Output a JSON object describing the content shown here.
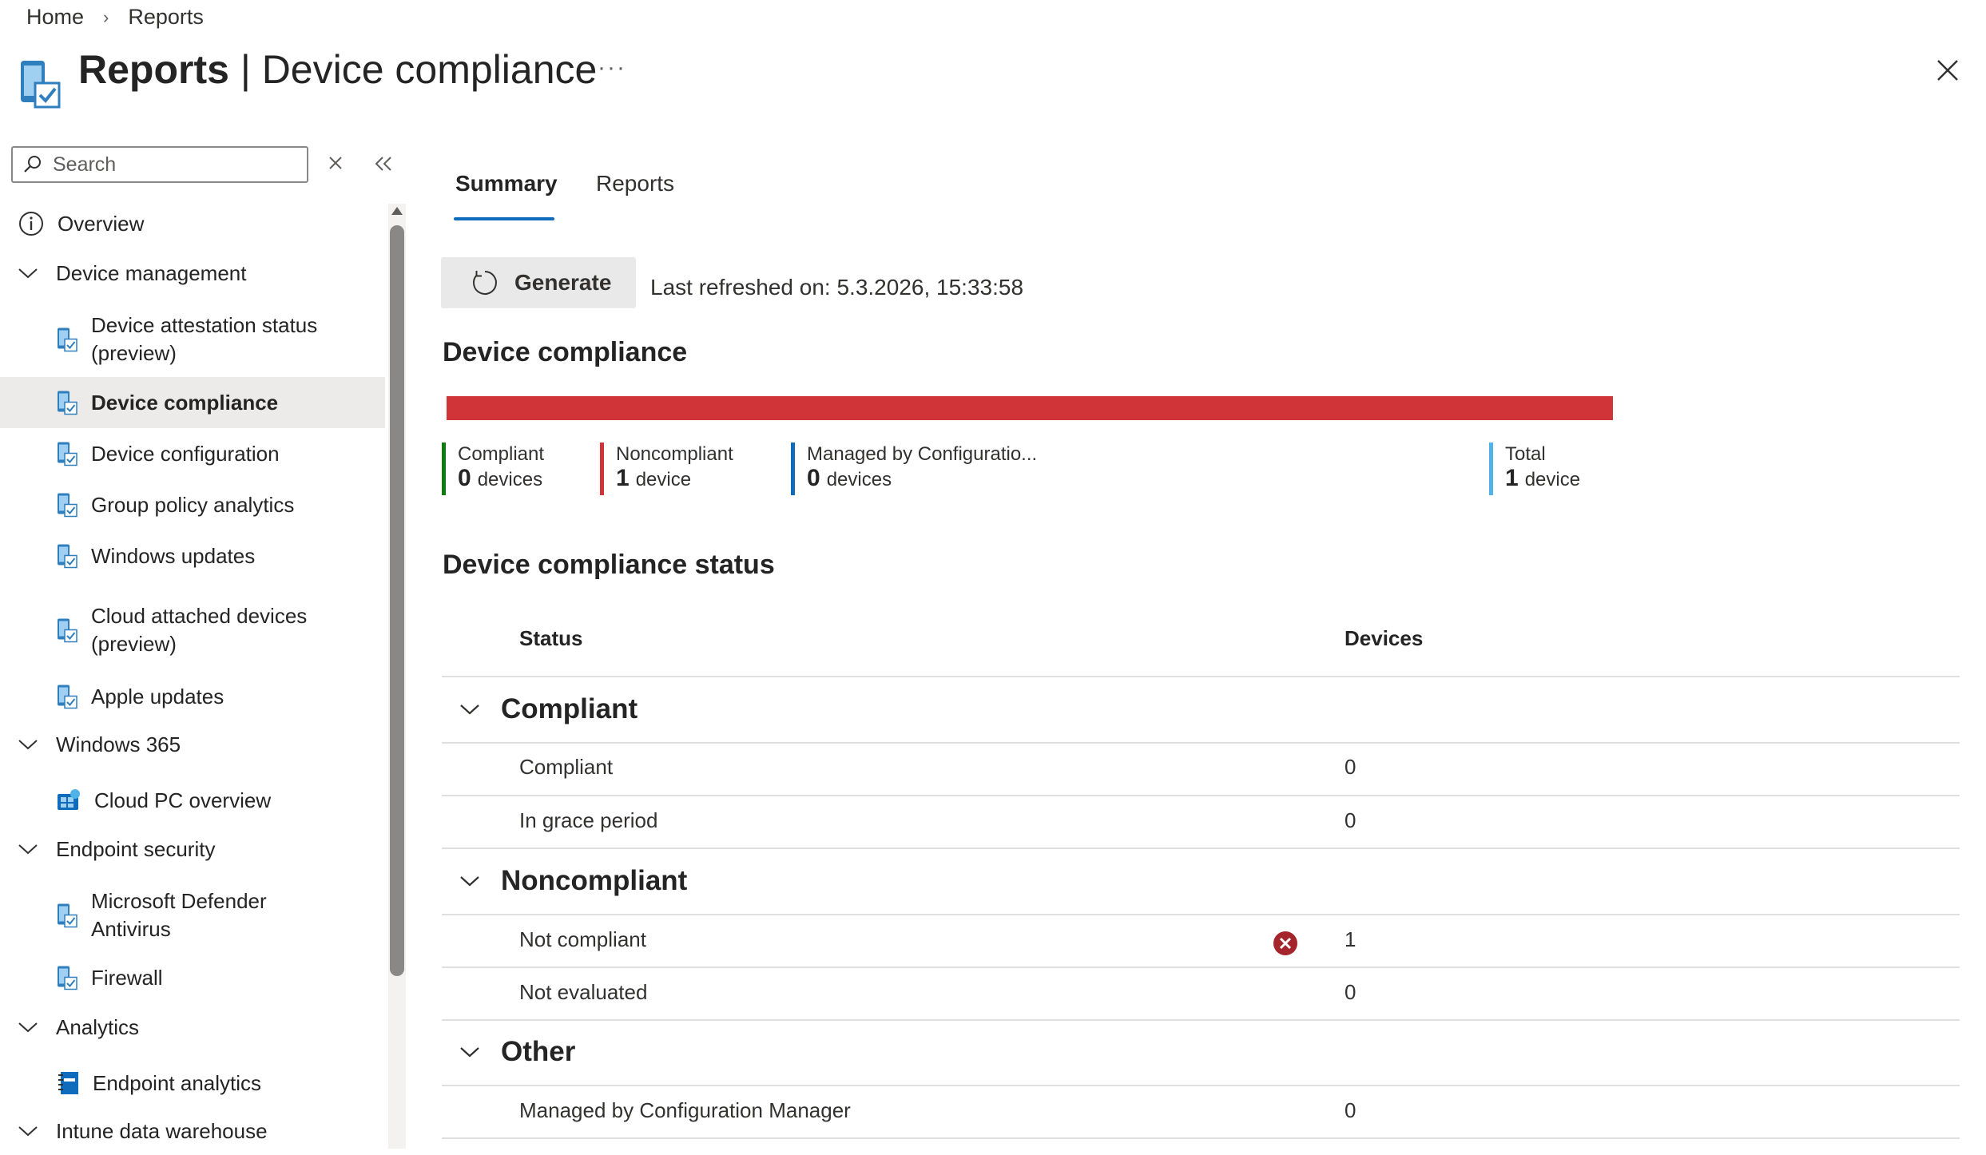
{
  "breadcrumb": {
    "home": "Home",
    "current": "Reports"
  },
  "header": {
    "title_bold": "Reports",
    "title_rest": " | Device compliance",
    "more": "···",
    "icon": "device-check-icon"
  },
  "sidebar": {
    "search_placeholder": "Search",
    "items": [
      {
        "label": "Overview",
        "icon": "info-icon",
        "type": "top"
      },
      {
        "label": "Device management",
        "icon": "chevron-down-icon",
        "type": "group"
      },
      {
        "label": "Device attestation status\n(preview)",
        "icon": "device-check-icon",
        "type": "child"
      },
      {
        "label": "Device compliance",
        "icon": "device-check-icon",
        "type": "child",
        "selected": true
      },
      {
        "label": "Device configuration",
        "icon": "device-check-icon",
        "type": "child"
      },
      {
        "label": "Group policy analytics",
        "icon": "device-check-icon",
        "type": "child"
      },
      {
        "label": "Windows updates",
        "icon": "device-check-icon",
        "type": "child"
      },
      {
        "label": "Cloud attached devices\n(preview)",
        "icon": "device-check-icon",
        "type": "child"
      },
      {
        "label": "Apple updates",
        "icon": "device-check-icon",
        "type": "child"
      },
      {
        "label": "Windows 365",
        "icon": "chevron-down-icon",
        "type": "group"
      },
      {
        "label": "Cloud PC overview",
        "icon": "cloud-pc-icon",
        "type": "child"
      },
      {
        "label": "Endpoint security",
        "icon": "chevron-down-icon",
        "type": "group"
      },
      {
        "label": "Microsoft Defender\nAntivirus",
        "icon": "device-check-icon",
        "type": "child"
      },
      {
        "label": "Firewall",
        "icon": "device-check-icon",
        "type": "child"
      },
      {
        "label": "Analytics",
        "icon": "chevron-down-icon",
        "type": "group"
      },
      {
        "label": "Endpoint analytics",
        "icon": "notebook-icon",
        "type": "child"
      },
      {
        "label": "Intune data warehouse",
        "icon": "chevron-down-icon",
        "type": "group"
      }
    ]
  },
  "tabs": [
    {
      "label": "Summary",
      "active": true
    },
    {
      "label": "Reports",
      "active": false
    }
  ],
  "toolbar": {
    "generate_label": "Generate",
    "last_refreshed": "Last refreshed on: 5.3.2026, 15:33:58"
  },
  "compliance": {
    "title": "Device compliance",
    "noncompliant_fraction": 1.0,
    "bar_color": "#d13438",
    "legend": [
      {
        "label": "Compliant",
        "count": "0",
        "unit": "devices",
        "color": "#107c10"
      },
      {
        "label": "Noncompliant",
        "count": "1",
        "unit": "device",
        "color": "#d13438"
      },
      {
        "label": "Managed by Configuratio...",
        "count": "0",
        "unit": "devices",
        "color": "#0f6cbd"
      },
      {
        "label": "Total",
        "count": "1",
        "unit": "device",
        "color": "#4fb3e8"
      }
    ]
  },
  "status_table": {
    "title": "Device compliance status",
    "headers": {
      "status": "Status",
      "devices": "Devices"
    },
    "groups": [
      {
        "name": "Compliant",
        "rows": [
          {
            "status": "Compliant",
            "devices": "0"
          },
          {
            "status": "In grace period",
            "devices": "0"
          }
        ]
      },
      {
        "name": "Noncompliant",
        "rows": [
          {
            "status": "Not compliant",
            "devices": "1",
            "icon": "error-icon"
          },
          {
            "status": "Not evaluated",
            "devices": "0"
          }
        ]
      },
      {
        "name": "Other",
        "rows": [
          {
            "status": "Managed by Configuration Manager",
            "devices": "0"
          }
        ]
      }
    ]
  }
}
